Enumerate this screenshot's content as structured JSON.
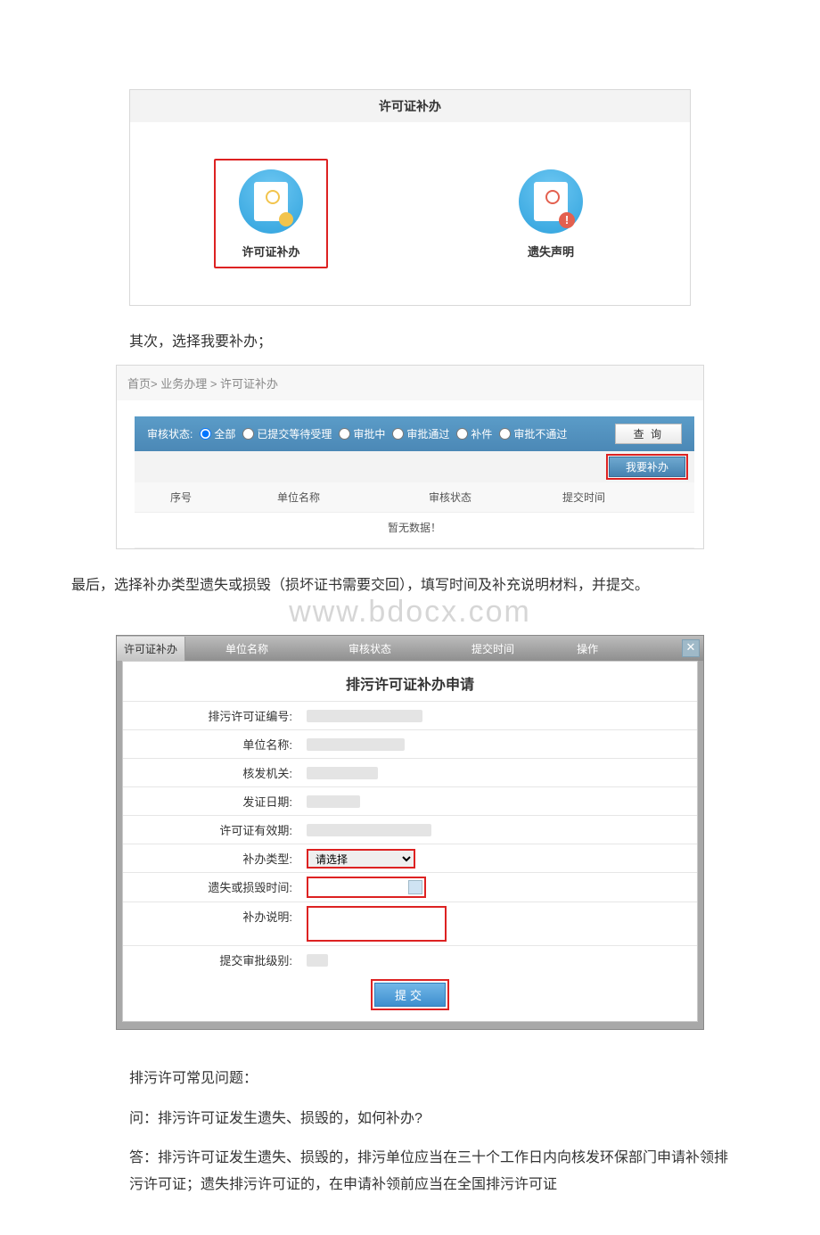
{
  "panel": {
    "title": "许可证补办",
    "options": [
      {
        "label": "许可证补办",
        "selected": true,
        "icon": "certificate-reissue-icon"
      },
      {
        "label": "遗失声明",
        "selected": false,
        "icon": "loss-statement-icon"
      }
    ]
  },
  "step2_text": "其次，选择我要补办；",
  "breadcrumb": "首页> 业务办理 > 许可证补办",
  "filter": {
    "label": "审核状态:",
    "items": [
      "全部",
      "已提交等待受理",
      "审批中",
      "审批通过",
      "补件",
      "审批不通过"
    ],
    "query_label": "查 询",
    "reissue_label": "我要补办"
  },
  "table": {
    "columns": [
      "序号",
      "单位名称",
      "审核状态",
      "提交时间"
    ],
    "nodata": "暂无数据！"
  },
  "step3_text": "最后，选择补办类型遗失或损毁（损坏证书需要交回），填写时间及补充说明材料，并提交。",
  "watermark": "www.bdocx.com",
  "form_tab": {
    "tab_label": "许可证补办",
    "cols": [
      "单位名称",
      "审核状态",
      "提交时间",
      "操作"
    ]
  },
  "form": {
    "title": "排污许可证补办申请",
    "fields": {
      "permit_no": "排污许可证编号:",
      "unit": "单位名称:",
      "issuer": "核发机关:",
      "issue_date": "发证日期:",
      "valid": "许可证有效期:",
      "type": "补办类型:",
      "lost_time": "遗失或损毁时间:",
      "note": "补办说明:",
      "level": "提交审批级别:"
    },
    "type_placeholder": "请选择",
    "submit_label": "提交"
  },
  "faq": {
    "heading": "排污许可常见问题：",
    "q": "问：排污许可证发生遗失、损毁的，如何补办?",
    "a": "答：排污许可证发生遗失、损毁的，排污单位应当在三十个工作日内向核发环保部门申请补领排污许可证；遗失排污许可证的，在申请补领前应当在全国排污许可证"
  }
}
